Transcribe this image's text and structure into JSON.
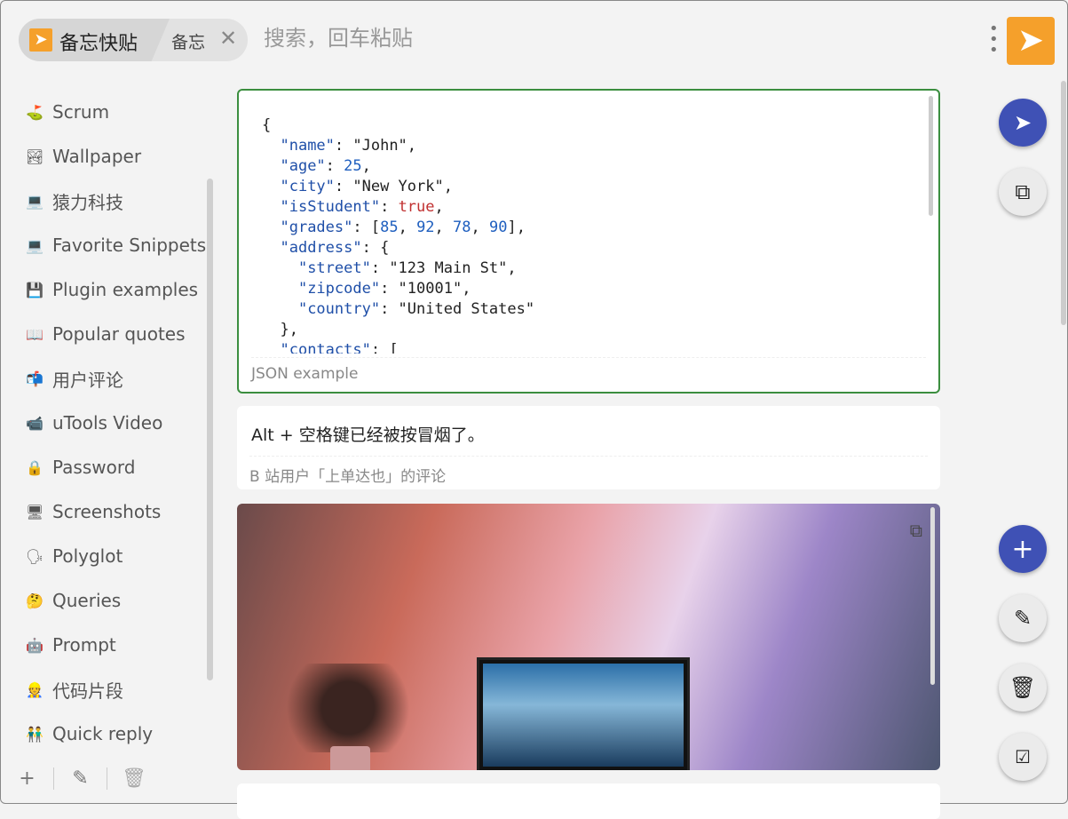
{
  "header": {
    "app_name": "备忘快贴",
    "tab": "备忘",
    "search_placeholder": "搜索，回车粘贴"
  },
  "sidebar": {
    "items": [
      {
        "icon": "⛳",
        "label": "Scrum"
      },
      {
        "icon": "🏞",
        "label": "Wallpaper"
      },
      {
        "icon": "💻",
        "label": "猿力科技"
      },
      {
        "icon": "💻",
        "label": "Favorite Snippets"
      },
      {
        "icon": "💾",
        "label": "Plugin examples"
      },
      {
        "icon": "📖",
        "label": "Popular quotes"
      },
      {
        "icon": "📬",
        "label": "用户评论"
      },
      {
        "icon": "📹",
        "label": "uTools Video"
      },
      {
        "icon": "🔒",
        "label": "Password"
      },
      {
        "icon": "🖥",
        "label": "Screenshots"
      },
      {
        "icon": "🗣",
        "label": "Polyglot"
      },
      {
        "icon": "🤔",
        "label": "Queries"
      },
      {
        "icon": "🤖",
        "label": "Prompt"
      },
      {
        "icon": "👷",
        "label": "代码片段"
      },
      {
        "icon": "👬",
        "label": "Quick reply"
      }
    ]
  },
  "cards": [
    {
      "caption": "JSON example"
    },
    {
      "text": "Alt + 空格键已经被按冒烟了。",
      "caption": "B 站用户「上单达也」的评论"
    }
  ]
}
